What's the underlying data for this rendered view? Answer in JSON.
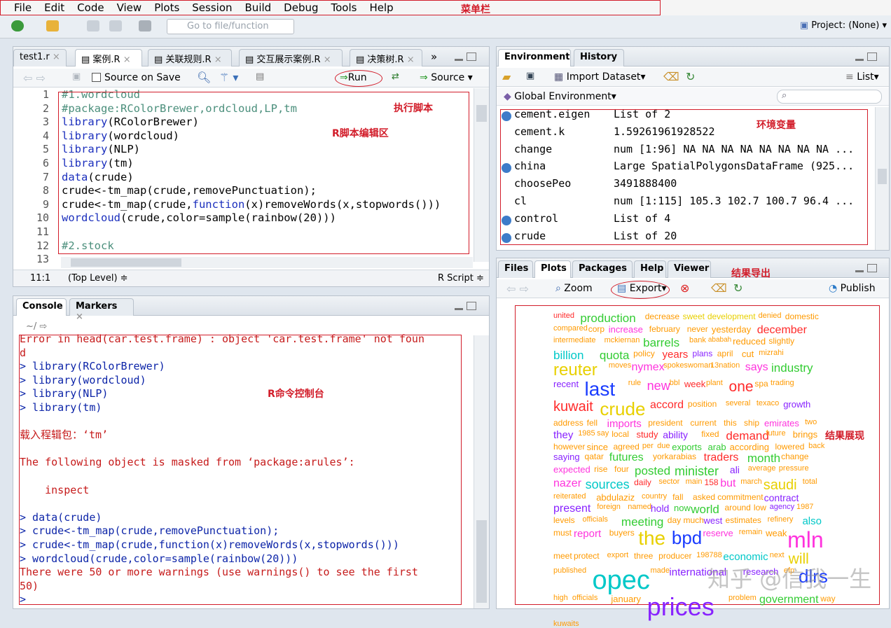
{
  "menu": {
    "items": [
      "File",
      "Edit",
      "Code",
      "View",
      "Plots",
      "Session",
      "Build",
      "Debug",
      "Tools",
      "Help"
    ],
    "annotation": "菜单栏"
  },
  "toolbar": {
    "goto_placeholder": "Go to file/function",
    "project": "Project: (None)"
  },
  "editor": {
    "tabs": [
      "test1.r",
      "案例.R",
      "关联规则.R",
      "交互展示案例.R",
      "决策树.R"
    ],
    "source_on_save": "Source on Save",
    "run": "Run",
    "source": "Source",
    "lines": [
      {
        "n": "1",
        "t": "#1.wordcloud"
      },
      {
        "n": "2",
        "t": "#package:RColorBrewer,ordcloud,LP,tm"
      },
      {
        "n": "3",
        "t": "library(RColorBrewer)"
      },
      {
        "n": "4",
        "t": "library(wordcloud)"
      },
      {
        "n": "5",
        "t": "library(NLP)"
      },
      {
        "n": "6",
        "t": "library(tm)"
      },
      {
        "n": "7",
        "t": "data(crude)"
      },
      {
        "n": "8",
        "t": "crude<-tm_map(crude,removePunctuation);"
      },
      {
        "n": "9",
        "t": "crude<-tm_map(crude,function(x)removeWords(x,stopwords()))"
      },
      {
        "n": "10",
        "t": "wordcloud(crude,color=sample(rainbow(20)))"
      },
      {
        "n": "11",
        "t": ""
      },
      {
        "n": "12",
        "t": "#2.stock"
      },
      {
        "n": "13",
        "t": ""
      }
    ],
    "status_pos": "11:1",
    "status_level": "(Top Level) ≑",
    "status_type": "R Script ≑",
    "annotation_run": "执行脚本",
    "annotation_area": "R脚本编辑区"
  },
  "console": {
    "tabs": [
      "Console",
      "Markers"
    ],
    "path": "~/",
    "lines": [
      {
        "t": "Error in head(car.test.frame) : object 'car.test.frame' not foun",
        "c": "err"
      },
      {
        "t": "d",
        "c": "err"
      },
      {
        "t": "> library(RColorBrewer)",
        "c": "blue"
      },
      {
        "t": "> library(wordcloud)",
        "c": "blue"
      },
      {
        "t": "> library(NLP)",
        "c": "blue"
      },
      {
        "t": "> library(tm)",
        "c": "blue"
      },
      {
        "t": "",
        "c": ""
      },
      {
        "t": "载入程辑包：‘tm’",
        "c": "err"
      },
      {
        "t": "",
        "c": ""
      },
      {
        "t": "The following object is masked from ‘package:arules’:",
        "c": "err"
      },
      {
        "t": "",
        "c": ""
      },
      {
        "t": "    inspect",
        "c": "err"
      },
      {
        "t": "",
        "c": ""
      },
      {
        "t": "> data(crude)",
        "c": "blue"
      },
      {
        "t": "> crude<-tm_map(crude,removePunctuation);",
        "c": "blue"
      },
      {
        "t": "> crude<-tm_map(crude,function(x)removeWords(x,stopwords()))",
        "c": "blue"
      },
      {
        "t": "> wordcloud(crude,color=sample(rainbow(20)))",
        "c": "blue"
      },
      {
        "t": "There were 50 or more warnings (use warnings() to see the first",
        "c": "err"
      },
      {
        "t": "50)",
        "c": "err"
      },
      {
        "t": ">",
        "c": "blue"
      }
    ],
    "annotation": "R命令控制台"
  },
  "environment": {
    "tabs": [
      "Environment",
      "History"
    ],
    "import": "Import Dataset",
    "list": "List",
    "scope": "Global Environment",
    "rows": [
      {
        "name": "cement.eigen",
        "value": "List of 2",
        "icon": true
      },
      {
        "name": "cement.k",
        "value": "1.59261961928522",
        "icon": false
      },
      {
        "name": "change",
        "value": "num [1:96] NA NA NA NA NA NA NA NA ...",
        "icon": false
      },
      {
        "name": "china",
        "value": "Large SpatialPolygonsDataFrame (925...",
        "icon": true
      },
      {
        "name": "choosePeo",
        "value": "3491888400",
        "icon": false
      },
      {
        "name": "cl",
        "value": "num [1:115] 105.3 102.7 100.7 96.4 ...",
        "icon": false
      },
      {
        "name": "control",
        "value": "List of 4",
        "icon": true
      },
      {
        "name": "crude",
        "value": "List of 20",
        "icon": true
      }
    ],
    "annotation": "环境变量"
  },
  "plots": {
    "tabs": [
      "Files",
      "Plots",
      "Packages",
      "Help",
      "Viewer"
    ],
    "zoom": "Zoom",
    "export": "Export",
    "publish": "Publish",
    "annotation_export": "结果导出",
    "annotation_area": "结果展现",
    "watermark": "知乎 @信我一生",
    "colors": {
      "red": "#ff2a2a",
      "orange": "#ff9a00",
      "yellow": "#e8d000",
      "green": "#33cc33",
      "cyan": "#00c8c8",
      "blue": "#1a3cff",
      "magenta": "#ff33dd",
      "purple": "#8822ff"
    },
    "words": [
      [
        "united",
        "red",
        11,
        0,
        0
      ],
      [
        "production",
        "green",
        17,
        0,
        0
      ],
      [
        "decrease",
        "orange",
        12,
        0,
        0
      ],
      [
        "sweet",
        "yellow",
        12,
        0,
        0
      ],
      [
        "development",
        "yellow",
        12,
        0,
        0
      ],
      [
        "denied",
        "orange",
        11,
        0,
        0
      ],
      [
        "domestic",
        "orange",
        12,
        0,
        0
      ],
      [
        "compared",
        "orange",
        11,
        0,
        0
      ],
      [
        "corp",
        "orange",
        12,
        0,
        0
      ],
      [
        "increase",
        "magenta",
        13,
        0,
        0
      ],
      [
        "february",
        "orange",
        12,
        0,
        0
      ],
      [
        "never",
        "orange",
        12,
        0,
        0
      ],
      [
        "yesterday",
        "orange",
        13,
        0,
        0
      ],
      [
        "december",
        "red",
        16,
        0,
        0
      ],
      [
        "intermediate",
        "orange",
        11,
        0,
        0
      ],
      [
        "mckiernan",
        "orange",
        11,
        0,
        0
      ],
      [
        "barrels",
        "green",
        17,
        0,
        0
      ],
      [
        "bank",
        "orange",
        11,
        0,
        0
      ],
      [
        "ababah",
        "orange",
        10,
        0,
        0
      ],
      [
        "reduced",
        "orange",
        13,
        0,
        0
      ],
      [
        "slightly",
        "orange",
        12,
        0,
        0
      ],
      [
        "billion",
        "cyan",
        17,
        0,
        0
      ],
      [
        "quota",
        "green",
        17,
        0,
        0
      ],
      [
        "policy",
        "orange",
        12,
        0,
        0
      ],
      [
        "years",
        "red",
        15,
        0,
        0
      ],
      [
        "plans",
        "purple",
        12,
        0,
        0
      ],
      [
        "april",
        "orange",
        12,
        0,
        0
      ],
      [
        "cut",
        "orange",
        13,
        0,
        0
      ],
      [
        "mizrahi",
        "orange",
        11,
        0,
        0
      ],
      [
        "reuter",
        "yellow",
        24,
        0,
        0
      ],
      [
        "moves",
        "orange",
        11,
        0,
        0
      ],
      [
        "nymex",
        "magenta",
        16,
        0,
        0
      ],
      [
        "spokeswoman",
        "orange",
        11,
        0,
        0
      ],
      [
        "13nation",
        "orange",
        11,
        0,
        0
      ],
      [
        "says",
        "magenta",
        16,
        0,
        0
      ],
      [
        "industry",
        "green",
        17,
        0,
        0
      ],
      [
        "recent",
        "purple",
        13,
        0,
        0
      ],
      [
        "last",
        "blue",
        28,
        0,
        0
      ],
      [
        "rule",
        "orange",
        11,
        0,
        0
      ],
      [
        "new",
        "magenta",
        18,
        0,
        0
      ],
      [
        "bbl",
        "orange",
        11,
        0,
        0
      ],
      [
        "week",
        "red",
        13,
        0,
        0
      ],
      [
        "plant",
        "orange",
        11,
        0,
        0
      ],
      [
        "one",
        "red",
        21,
        0,
        0
      ],
      [
        "spa",
        "orange",
        12,
        0,
        0
      ],
      [
        "trading",
        "orange",
        11,
        0,
        0
      ],
      [
        "kuwait",
        "red",
        20,
        0,
        0
      ],
      [
        "crude",
        "yellow",
        26,
        0,
        0
      ],
      [
        "accord",
        "red",
        16,
        0,
        0
      ],
      [
        "position",
        "orange",
        12,
        0,
        0
      ],
      [
        "several",
        "orange",
        11,
        0,
        0
      ],
      [
        "texaco",
        "orange",
        11,
        0,
        0
      ],
      [
        "growth",
        "purple",
        13,
        0,
        0
      ],
      [
        "address",
        "orange",
        12,
        0,
        0
      ],
      [
        "fell",
        "orange",
        12,
        0,
        0
      ],
      [
        "imports",
        "magenta",
        15,
        0,
        0
      ],
      [
        "president",
        "orange",
        12,
        0,
        0
      ],
      [
        "current",
        "orange",
        12,
        0,
        0
      ],
      [
        "this",
        "orange",
        12,
        0,
        0
      ],
      [
        "ship",
        "orange",
        12,
        0,
        0
      ],
      [
        "emirates",
        "magenta",
        13,
        0,
        0
      ],
      [
        "two",
        "orange",
        11,
        0,
        0
      ],
      [
        "they",
        "purple",
        15,
        0,
        0
      ],
      [
        "1985",
        "orange",
        11,
        0,
        0
      ],
      [
        "say",
        "orange",
        11,
        0,
        0
      ],
      [
        "local",
        "orange",
        12,
        0,
        0
      ],
      [
        "study",
        "red",
        13,
        0,
        0
      ],
      [
        "ability",
        "purple",
        14,
        0,
        0
      ],
      [
        "fixed",
        "orange",
        12,
        0,
        0
      ],
      [
        "demand",
        "red",
        17,
        0,
        0
      ],
      [
        "future",
        "orange",
        11,
        0,
        0
      ],
      [
        "brings",
        "orange",
        13,
        0,
        0
      ],
      [
        "however",
        "orange",
        12,
        0,
        0
      ],
      [
        "since",
        "orange",
        13,
        0,
        0
      ],
      [
        "agreed",
        "orange",
        12,
        0,
        0
      ],
      [
        "per",
        "orange",
        11,
        0,
        0
      ],
      [
        "due",
        "orange",
        11,
        0,
        0
      ],
      [
        "exports",
        "green",
        13,
        0,
        0
      ],
      [
        "arab",
        "green",
        13,
        0,
        0
      ],
      [
        "according",
        "orange",
        13,
        0,
        0
      ],
      [
        "lowered",
        "orange",
        12,
        0,
        0
      ],
      [
        "back",
        "orange",
        11,
        0,
        0
      ],
      [
        "saying",
        "purple",
        13,
        0,
        0
      ],
      [
        "qatar",
        "orange",
        12,
        0,
        0
      ],
      [
        "futures",
        "green",
        16,
        0,
        0
      ],
      [
        "yorkarabias",
        "orange",
        12,
        0,
        0
      ],
      [
        "traders",
        "red",
        16,
        0,
        0
      ],
      [
        "month",
        "green",
        17,
        0,
        0
      ],
      [
        "change",
        "orange",
        12,
        0,
        0
      ],
      [
        "expected",
        "magenta",
        13,
        0,
        0
      ],
      [
        "rise",
        "orange",
        12,
        0,
        0
      ],
      [
        "four",
        "orange",
        12,
        0,
        0
      ],
      [
        "posted",
        "green",
        17,
        0,
        0
      ],
      [
        "minister",
        "green",
        18,
        0,
        0
      ],
      [
        "ali",
        "purple",
        14,
        0,
        0
      ],
      [
        "average",
        "orange",
        11,
        0,
        0
      ],
      [
        "pressure",
        "orange",
        11,
        0,
        0
      ],
      [
        "nazer",
        "magenta",
        16,
        0,
        0
      ],
      [
        "sources",
        "cyan",
        18,
        0,
        0
      ],
      [
        "daily",
        "red",
        12,
        0,
        0
      ],
      [
        "sector",
        "orange",
        11,
        0,
        0
      ],
      [
        "main",
        "orange",
        11,
        0,
        0
      ],
      [
        "158",
        "red",
        12,
        0,
        0
      ],
      [
        "but",
        "magenta",
        16,
        0,
        0
      ],
      [
        "march",
        "orange",
        11,
        0,
        0
      ],
      [
        "saudi",
        "yellow",
        20,
        0,
        0
      ],
      [
        "total",
        "orange",
        11,
        0,
        0
      ],
      [
        "reiterated",
        "orange",
        11,
        0,
        0
      ],
      [
        "abdulaziz",
        "orange",
        13,
        0,
        0
      ],
      [
        "country",
        "orange",
        11,
        0,
        0
      ],
      [
        "fall",
        "orange",
        12,
        0,
        0
      ],
      [
        "asked",
        "orange",
        12,
        0,
        0
      ],
      [
        "commitment",
        "orange",
        12,
        0,
        0
      ],
      [
        "contract",
        "purple",
        14,
        0,
        0
      ],
      [
        "present",
        "purple",
        16,
        0,
        0
      ],
      [
        "foreign",
        "orange",
        11,
        0,
        0
      ],
      [
        "named",
        "orange",
        11,
        0,
        0
      ],
      [
        "hold",
        "purple",
        14,
        0,
        0
      ],
      [
        "now",
        "green",
        13,
        0,
        0
      ],
      [
        "world",
        "green",
        17,
        0,
        0
      ],
      [
        "around",
        "orange",
        12,
        0,
        0
      ],
      [
        "low",
        "orange",
        12,
        0,
        0
      ],
      [
        "agency",
        "purple",
        11,
        0,
        0
      ],
      [
        "1987",
        "orange",
        11,
        0,
        0
      ],
      [
        "levels",
        "orange",
        12,
        0,
        0
      ],
      [
        "officials",
        "orange",
        11,
        0,
        0
      ],
      [
        "meeting",
        "green",
        17,
        0,
        0
      ],
      [
        "day",
        "orange",
        12,
        0,
        0
      ],
      [
        "much",
        "orange",
        12,
        0,
        0
      ],
      [
        "west",
        "purple",
        13,
        0,
        0
      ],
      [
        "estimates",
        "orange",
        12,
        0,
        0
      ],
      [
        "refinery",
        "orange",
        11,
        0,
        0
      ],
      [
        "also",
        "cyan",
        15,
        0,
        0
      ],
      [
        "must",
        "orange",
        12,
        0,
        0
      ],
      [
        "report",
        "magenta",
        15,
        0,
        0
      ],
      [
        "buyers",
        "orange",
        12,
        0,
        0
      ],
      [
        "the",
        "yellow",
        28,
        0,
        0
      ],
      [
        "bpd",
        "blue",
        26,
        0,
        0
      ],
      [
        "reserve",
        "magenta",
        13,
        0,
        0
      ],
      [
        "remain",
        "orange",
        11,
        0,
        0
      ],
      [
        "weak",
        "orange",
        13,
        0,
        0
      ],
      [
        "mln",
        "magenta",
        32,
        0,
        0
      ],
      [
        "meet",
        "orange",
        12,
        0,
        0
      ],
      [
        "protect",
        "orange",
        12,
        0,
        0
      ],
      [
        "export",
        "orange",
        11,
        0,
        0
      ],
      [
        "three",
        "orange",
        12,
        0,
        0
      ],
      [
        "producer",
        "orange",
        12,
        0,
        0
      ],
      [
        "198788",
        "orange",
        11,
        0,
        0
      ],
      [
        "economic",
        "cyan",
        15,
        0,
        0
      ],
      [
        "next",
        "orange",
        11,
        0,
        0
      ],
      [
        "will",
        "yellow",
        21,
        0,
        0
      ],
      [
        "published",
        "orange",
        11,
        0,
        0
      ],
      [
        "opec",
        "cyan",
        38,
        0,
        0
      ],
      [
        "made",
        "orange",
        11,
        0,
        0
      ],
      [
        "international",
        "purple",
        15,
        0,
        0
      ],
      [
        "research",
        "purple",
        13,
        0,
        0
      ],
      [
        "efp",
        "orange",
        11,
        0,
        0
      ],
      [
        "dlrs",
        "blue",
        26,
        0,
        0
      ],
      [
        "high",
        "orange",
        11,
        0,
        0
      ],
      [
        "officials",
        "orange",
        11,
        0,
        0
      ],
      [
        "january",
        "orange",
        13,
        0,
        0
      ],
      [
        "prices",
        "purple",
        36,
        0,
        0
      ],
      [
        "problem",
        "orange",
        11,
        0,
        0
      ],
      [
        "government",
        "green",
        16,
        0,
        0
      ],
      [
        "way",
        "orange",
        12,
        0,
        0
      ],
      [
        "kuwaits",
        "orange",
        11,
        0,
        0
      ]
    ]
  }
}
